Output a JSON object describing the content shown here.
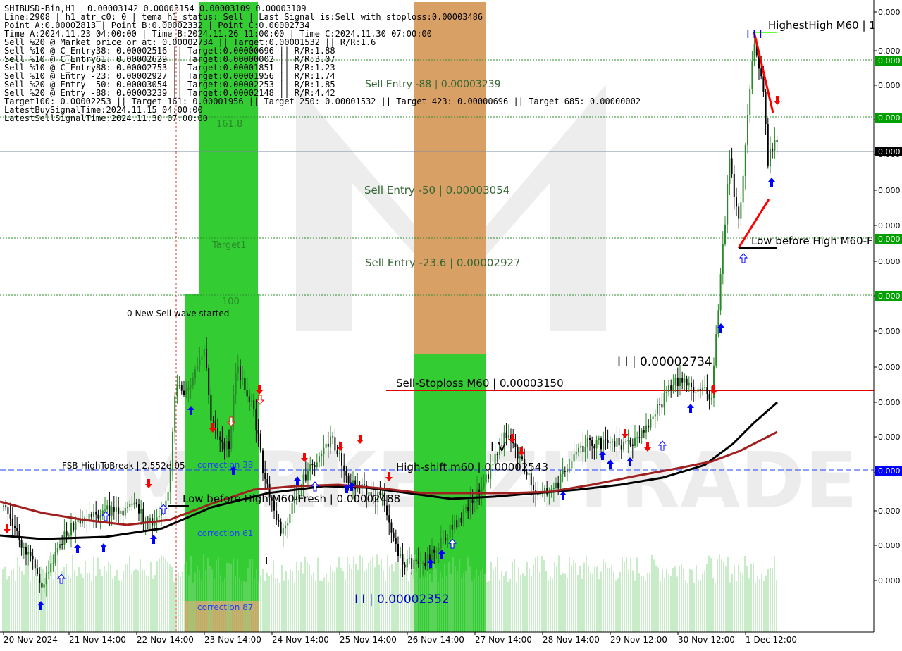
{
  "window": {
    "symbol_timeframe": "SHIBUSD-Bin,H1",
    "ohlc": "0.00003142 0.00003154 0.00003109 0.00003109"
  },
  "info_lines": [
    "Line:2908 | h1_atr_c0: 0 | tema_h1_status: Sell | Last Signal is:Sell with stoploss:0.00003486",
    "Point A:0.00002813 | Point B:0.00002332 | Point C:0.00002734",
    "Time A:2024.11.23 04:00:00 | Time B:2024.11.26 11:00:00 | Time C:2024.11.30 07:00:00",
    "Sell %20 @ Market price or at: 0.00002734 || Target:0.00001532 || R/R:1.6",
    "Sell %10 @ C_Entry38: 0.00002516 || Target:0.00000696 || R/R:1.88",
    "Sell %10 @ C_Entry61: 0.00002629 || Target:0.00000002 || R/R:3.07",
    "Sell %10 @ C_Entry88: 0.00002753 || Target:0.00001851 || R/R:1.23",
    "Sell %10 @ Entry -23: 0.00002927 || Target:0.00001956 || R/R:1.74",
    "Sell %20 @ Entry -50: 0.00003054 || Target:0.00002253 || R/R:1.85",
    "Sell %20 @ Entry -88: 0.00003239 || Target:0.00002148 || R/R:4.42",
    "Target100: 0.00002253 || Target 161: 0.00001956 || Target 250: 0.00001532 || Target 423: 0.00000696 || Target 685: 0.00000002",
    "LatestBuySignalTime:2024.11.15 04:00:00",
    "LatestSellSignalTime:2024.11.30 07:00:00"
  ],
  "labels": {
    "sell_entry_88": "Sell Entry -88 | 0.00003239",
    "sell_entry_50": "Sell Entry -50 | 0.00003054",
    "sell_entry_236": "Sell Entry -23.6 | 0.00002927",
    "sell_stoploss": "Sell-Stoploss M60 | 0.00003150",
    "high_shift": "High-shift m60 | 0.00002543",
    "low_before_high_fresh": "Low before High   M60-Fresh | 0.00002488",
    "point_c": "I I | 0.00002734",
    "point_b": "I I | 0.00002352",
    "iv": "I V",
    "highest_high": "HighestHigh   M60 | 1",
    "low_before_high": "Low before High   M60-F",
    "fsb": "FSB-HighToBreak | 2.552e-05",
    "new_sell_wave": "0 New Sell wave started",
    "t_1618": "161.8",
    "t_target1": "Target1",
    "t_100": "100",
    "corr_38": "correction 38",
    "corr_61": "correction 61",
    "corr_87": "correction 87",
    "i_mark": "I",
    "watermark": "MARKETZITRADE"
  },
  "price_axis": {
    "ticks": [
      "0.000",
      "0.000",
      "0.000",
      "0.000",
      "0.000",
      "0.000",
      "0.000",
      "0.000",
      "0.000",
      "0.000",
      "0.000",
      "0.000",
      "0.000",
      "0.000",
      "0.000",
      "0.000",
      "0.000"
    ],
    "badges": [
      "0.000",
      "0.000",
      "0.000",
      "0.000",
      "0.000",
      "0.000"
    ]
  },
  "time_axis": [
    "20 Nov 2024",
    "21 Nov 14:00",
    "22 Nov 14:00",
    "23 Nov 14:00",
    "24 Nov 14:00",
    "25 Nov 14:00",
    "26 Nov 14:00",
    "27 Nov 14:00",
    "28 Nov 14:00",
    "29 Nov 12:00",
    "30 Nov 12:00",
    "1 Dec 12:00"
  ],
  "colors": {
    "green_zone": "#33cc33",
    "orange_zone": "#d9a066",
    "sell_arrow": "#ff0000",
    "buy_arrow": "#0000ff",
    "stoploss_line": "#e00000",
    "ma_black": "#000000",
    "ma_brown": "#a02020",
    "badge_green": "#00a000",
    "badge_blue": "#0000ff",
    "badge_black": "#000000"
  }
}
